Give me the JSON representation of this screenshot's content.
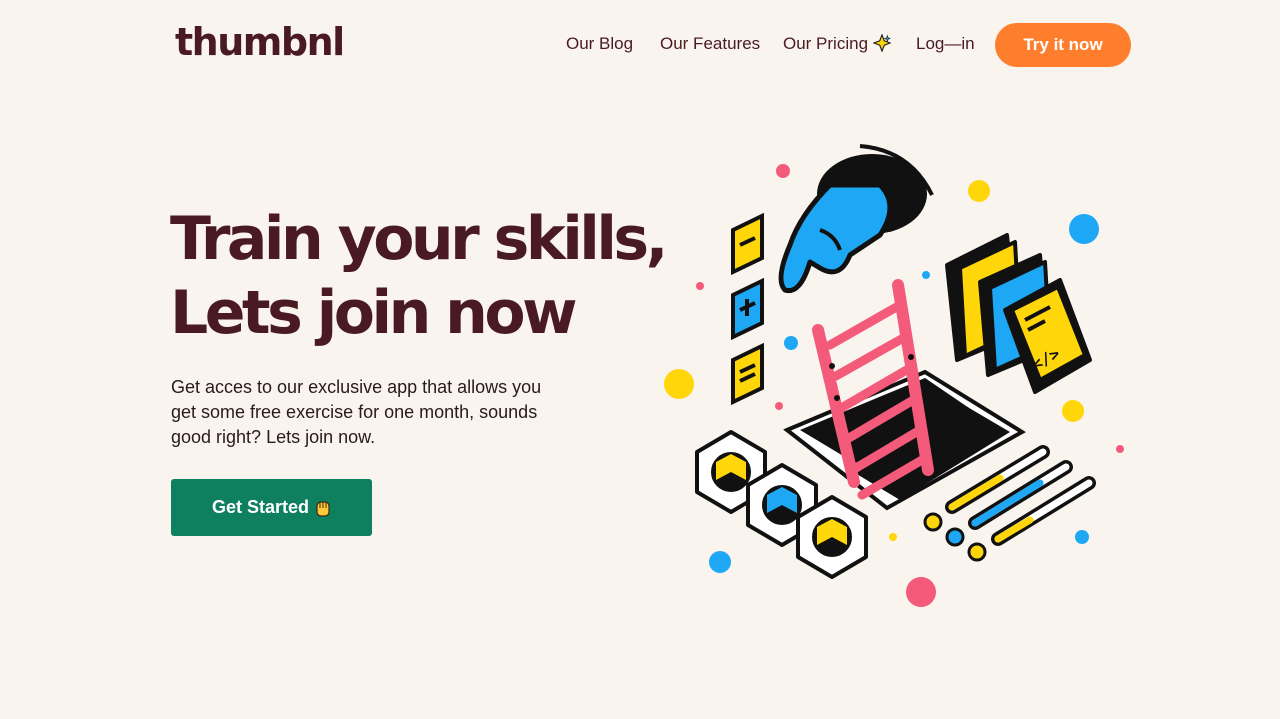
{
  "brand": {
    "logo": "thumbnl"
  },
  "nav": {
    "items": [
      {
        "label": "Our Blog"
      },
      {
        "label": "Our Features"
      },
      {
        "label": "Our Pricing",
        "icon": "sparkle-icon"
      },
      {
        "label": "Log—in"
      }
    ],
    "cta": "Try it now"
  },
  "hero": {
    "headline_line1": "Train your skills,",
    "headline_line2": "Lets join now",
    "subtitle": "Get acces to our exclusive app that allows you get some free exercise for one month, sounds good right? Lets join now.",
    "button_label": "Get Started",
    "button_icon": "hand-icon"
  },
  "colors": {
    "background": "#f9f4ee",
    "text": "#4a1a22",
    "cta_orange": "#ff7e2e",
    "button_green": "#0e8060",
    "accent_blue": "#1ea7f5",
    "accent_yellow": "#ffd60a",
    "accent_pink": "#f45b7a"
  }
}
